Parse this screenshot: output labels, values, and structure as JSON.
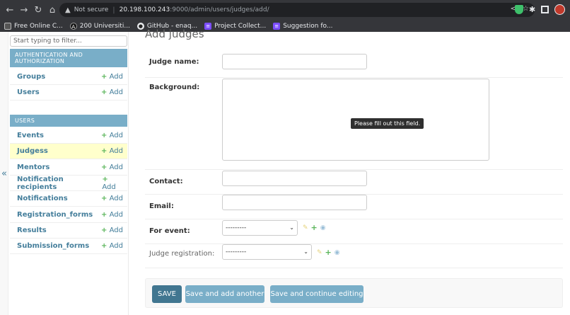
{
  "browser": {
    "security_label": "Not secure",
    "separator": "|",
    "url_host": "20.198.100.243",
    "url_path": ":9000/admin/users/judges/add/",
    "bookmarks": [
      {
        "label": "Free Online C...",
        "icon": "calendar-icon"
      },
      {
        "label": "200 Universiti...",
        "icon": "a-logo-icon"
      },
      {
        "label": "GitHub - enaq...",
        "icon": "github-icon"
      },
      {
        "label": "Project Collect...",
        "icon": "list-icon"
      },
      {
        "label": "Suggestion fo...",
        "icon": "list-icon"
      }
    ]
  },
  "sidebar": {
    "collapse_symbol": "«",
    "filter_placeholder": "Start typing to filter...",
    "modules": [
      {
        "title": "AUTHENTICATION AND AUTHORIZATION",
        "models": [
          {
            "name": "Groups",
            "add": "Add",
            "active": false
          },
          {
            "name": "Users",
            "add": "Add",
            "active": false
          }
        ]
      },
      {
        "title": "USERS",
        "models": [
          {
            "name": "Events",
            "add": "Add",
            "active": false
          },
          {
            "name": "Judgess",
            "add": "Add",
            "active": true
          },
          {
            "name": "Mentors",
            "add": "Add",
            "active": false
          },
          {
            "name": "Notification recipients",
            "add": "Add",
            "active": false
          },
          {
            "name": "Notifications",
            "add": "Add",
            "active": false
          },
          {
            "name": "Registration_forms",
            "add": "Add",
            "active": false
          },
          {
            "name": "Results",
            "add": "Add",
            "active": false
          },
          {
            "name": "Submission_forms",
            "add": "Add",
            "active": false
          }
        ]
      }
    ]
  },
  "main": {
    "title": "Add judges",
    "fields": {
      "judge_name": {
        "label": "Judge name:",
        "value": ""
      },
      "background": {
        "label": "Background:",
        "value": ""
      },
      "contact": {
        "label": "Contact:",
        "value": ""
      },
      "email": {
        "label": "Email:",
        "value": ""
      },
      "for_event": {
        "label": "For event:",
        "selected": "---------"
      },
      "judge_registration": {
        "label": "Judge registration:",
        "selected": "---------"
      }
    },
    "tooltip": "Please fill out this field.",
    "buttons": {
      "save": "SAVE",
      "save_add_another": "Save and add another",
      "save_continue": "Save and continue editing"
    }
  },
  "colors": {
    "module_header": "#79aec8",
    "link": "#447e9b",
    "active_row": "#ffffcc",
    "primary_button": "#417690",
    "secondary_button": "#79aec8",
    "add_plus": "#5ab55a"
  }
}
